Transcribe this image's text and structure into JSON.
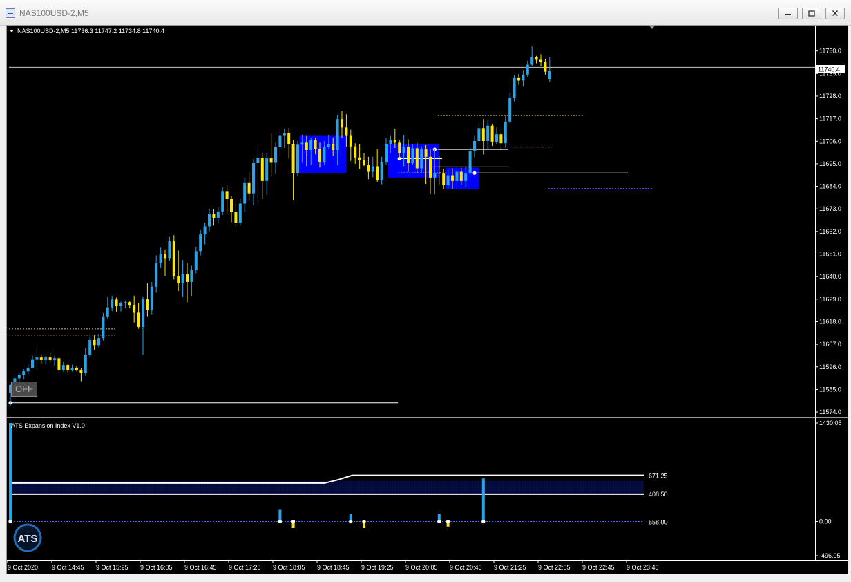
{
  "window": {
    "title": "NAS100USD-2,M5"
  },
  "main_chart": {
    "header": "NAS100USD-2,M5  11736.3 11747.2 11734.8 11740.4",
    "current_price_label": "11740.4",
    "price_axis": [
      "11750.0",
      "11739.0",
      "11728.0",
      "11717.0",
      "11706.0",
      "11695.0",
      "11684.0",
      "11673.0",
      "11662.0",
      "11651.0",
      "11640.0",
      "11629.0",
      "11618.0",
      "11607.0",
      "11596.0",
      "11585.0",
      "11574.0"
    ],
    "off_button_label": "OFF"
  },
  "indicator": {
    "name": "ATS Expansion Index V1.0",
    "axis": [
      "1430.05",
      "0.00",
      "-496.05"
    ],
    "level_labels": [
      "671.25",
      "558.00",
      "408.50"
    ],
    "logo_text": "ATS"
  },
  "time_axis": [
    "9 Oct 2020",
    "9 Oct 14:45",
    "9 Oct 15:25",
    "9 Oct 16:05",
    "9 Oct 16:45",
    "9 Oct 17:25",
    "9 Oct 18:05",
    "9 Oct 18:45",
    "9 Oct 19:25",
    "9 Oct 20:05",
    "9 Oct 20:45",
    "9 Oct 21:25",
    "9 Oct 22:05",
    "9 Oct 22:45",
    "9 Oct 23:40"
  ],
  "colors": {
    "bull": "#2aa4e8",
    "bear": "#ffe800",
    "zone": "#0000ff",
    "background": "#000000",
    "axis_text": "#ffffff"
  },
  "chart_data": {
    "type": "candlestick",
    "symbol": "NAS100USD-2",
    "timeframe": "M5",
    "ylim": [
      11572,
      11760
    ],
    "last_ohlc": {
      "open": 11736.3,
      "high": 11747.2,
      "low": 11734.8,
      "close": 11740.4
    },
    "candles": [
      {
        "o": 11583.5,
        "h": 11587.8,
        "l": 11576.9,
        "c": 11587.2
      },
      {
        "o": 11587.2,
        "h": 11592.6,
        "l": 11585.1,
        "c": 11590.4
      },
      {
        "o": 11590.4,
        "h": 11593.0,
        "l": 11586.9,
        "c": 11592.2
      },
      {
        "o": 11592.2,
        "h": 11594.9,
        "l": 11589.8,
        "c": 11593.8
      },
      {
        "o": 11593.8,
        "h": 11597.4,
        "l": 11591.8,
        "c": 11595.6
      },
      {
        "o": 11595.6,
        "h": 11601.4,
        "l": 11595.2,
        "c": 11599.4
      },
      {
        "o": 11599.4,
        "h": 11605.3,
        "l": 11594.7,
        "c": 11600.6
      },
      {
        "o": 11600.6,
        "h": 11602.2,
        "l": 11597.3,
        "c": 11599.3
      },
      {
        "o": 11599.3,
        "h": 11601.3,
        "l": 11597.3,
        "c": 11600.6
      },
      {
        "o": 11600.6,
        "h": 11602.6,
        "l": 11598.6,
        "c": 11599.3
      },
      {
        "o": 11599.3,
        "h": 11601.3,
        "l": 11596.5,
        "c": 11600.2
      },
      {
        "o": 11600.2,
        "h": 11601.1,
        "l": 11593.0,
        "c": 11594.3
      },
      {
        "o": 11594.3,
        "h": 11598.6,
        "l": 11593.8,
        "c": 11596.9
      },
      {
        "o": 11596.9,
        "h": 11597.5,
        "l": 11593.4,
        "c": 11594.3
      },
      {
        "o": 11594.3,
        "h": 11597.1,
        "l": 11593.8,
        "c": 11595.6
      },
      {
        "o": 11595.6,
        "h": 11596.5,
        "l": 11593.8,
        "c": 11594.3
      },
      {
        "o": 11594.3,
        "h": 11595.6,
        "l": 11589.0,
        "c": 11593.0
      },
      {
        "o": 11593.0,
        "h": 11605.3,
        "l": 11591.6,
        "c": 11602.0
      },
      {
        "o": 11602.0,
        "h": 11611.0,
        "l": 11600.6,
        "c": 11609.1
      },
      {
        "o": 11609.1,
        "h": 11611.4,
        "l": 11604.2,
        "c": 11606.6
      },
      {
        "o": 11606.6,
        "h": 11612.1,
        "l": 11605.5,
        "c": 11610.0
      },
      {
        "o": 11610.0,
        "h": 11622.3,
        "l": 11608.8,
        "c": 11620.6
      },
      {
        "o": 11620.6,
        "h": 11630.2,
        "l": 11619.3,
        "c": 11625.0
      },
      {
        "o": 11625.0,
        "h": 11630.7,
        "l": 11623.2,
        "c": 11628.8
      },
      {
        "o": 11628.8,
        "h": 11629.8,
        "l": 11622.8,
        "c": 11625.9
      },
      {
        "o": 11625.9,
        "h": 11627.8,
        "l": 11623.0,
        "c": 11627.1
      },
      {
        "o": 11627.1,
        "h": 11628.4,
        "l": 11624.5,
        "c": 11627.5
      },
      {
        "o": 11627.5,
        "h": 11628.0,
        "l": 11624.5,
        "c": 11626.2
      },
      {
        "o": 11626.2,
        "h": 11630.7,
        "l": 11617.6,
        "c": 11622.4
      },
      {
        "o": 11622.4,
        "h": 11627.1,
        "l": 11614.6,
        "c": 11615.5
      },
      {
        "o": 11615.5,
        "h": 11630.2,
        "l": 11602.0,
        "c": 11628.9
      },
      {
        "o": 11628.9,
        "h": 11636.8,
        "l": 11620.6,
        "c": 11623.6
      },
      {
        "o": 11623.6,
        "h": 11637.4,
        "l": 11621.7,
        "c": 11635.1
      },
      {
        "o": 11635.1,
        "h": 11650.3,
        "l": 11632.2,
        "c": 11646.7
      },
      {
        "o": 11646.7,
        "h": 11654.1,
        "l": 11644.1,
        "c": 11651.1
      },
      {
        "o": 11651.1,
        "h": 11653.3,
        "l": 11640.4,
        "c": 11649.0
      },
      {
        "o": 11649.0,
        "h": 11659.3,
        "l": 11647.8,
        "c": 11657.2
      },
      {
        "o": 11657.2,
        "h": 11660.2,
        "l": 11638.6,
        "c": 11640.4
      },
      {
        "o": 11640.4,
        "h": 11652.7,
        "l": 11633.0,
        "c": 11636.8
      },
      {
        "o": 11636.8,
        "h": 11648.1,
        "l": 11630.2,
        "c": 11641.2
      },
      {
        "o": 11641.2,
        "h": 11646.5,
        "l": 11627.5,
        "c": 11637.4
      },
      {
        "o": 11637.4,
        "h": 11645.3,
        "l": 11630.6,
        "c": 11643.2
      },
      {
        "o": 11643.2,
        "h": 11654.5,
        "l": 11641.6,
        "c": 11652.4
      },
      {
        "o": 11652.4,
        "h": 11662.6,
        "l": 11650.3,
        "c": 11660.6
      },
      {
        "o": 11660.6,
        "h": 11666.3,
        "l": 11655.7,
        "c": 11664.5
      },
      {
        "o": 11664.5,
        "h": 11673.1,
        "l": 11662.1,
        "c": 11670.7
      },
      {
        "o": 11670.7,
        "h": 11672.9,
        "l": 11664.9,
        "c": 11668.7
      },
      {
        "o": 11668.7,
        "h": 11674.0,
        "l": 11665.8,
        "c": 11671.8
      },
      {
        "o": 11671.8,
        "h": 11683.5,
        "l": 11670.0,
        "c": 11681.4
      },
      {
        "o": 11681.4,
        "h": 11684.9,
        "l": 11670.3,
        "c": 11677.8
      },
      {
        "o": 11677.8,
        "h": 11679.3,
        "l": 11666.5,
        "c": 11671.4
      },
      {
        "o": 11671.4,
        "h": 11676.2,
        "l": 11664.0,
        "c": 11666.3
      },
      {
        "o": 11666.3,
        "h": 11677.8,
        "l": 11664.9,
        "c": 11675.6
      },
      {
        "o": 11675.6,
        "h": 11688.3,
        "l": 11671.3,
        "c": 11685.6
      },
      {
        "o": 11685.6,
        "h": 11690.7,
        "l": 11676.9,
        "c": 11680.6
      },
      {
        "o": 11680.6,
        "h": 11697.3,
        "l": 11674.7,
        "c": 11695.3
      },
      {
        "o": 11695.3,
        "h": 11702.8,
        "l": 11675.7,
        "c": 11698.0
      },
      {
        "o": 11698.0,
        "h": 11700.4,
        "l": 11677.8,
        "c": 11686.6
      },
      {
        "o": 11686.6,
        "h": 11700.4,
        "l": 11680.0,
        "c": 11697.7
      },
      {
        "o": 11697.7,
        "h": 11710.1,
        "l": 11689.3,
        "c": 11695.5
      },
      {
        "o": 11695.5,
        "h": 11705.3,
        "l": 11690.0,
        "c": 11703.2
      },
      {
        "o": 11703.2,
        "h": 11712.0,
        "l": 11697.8,
        "c": 11708.6
      },
      {
        "o": 11708.6,
        "h": 11712.2,
        "l": 11702.7,
        "c": 11710.1
      },
      {
        "o": 11710.1,
        "h": 11712.4,
        "l": 11697.5,
        "c": 11704.5
      },
      {
        "o": 11704.5,
        "h": 11706.6,
        "l": 11677.2,
        "c": 11690.6
      },
      {
        "o": 11690.6,
        "h": 11706.0,
        "l": 11689.0,
        "c": 11704.3
      },
      {
        "o": 11704.3,
        "h": 11709.0,
        "l": 11695.5,
        "c": 11705.3
      },
      {
        "o": 11705.3,
        "h": 11708.6,
        "l": 11693.9,
        "c": 11701.7
      },
      {
        "o": 11701.7,
        "h": 11707.8,
        "l": 11694.5,
        "c": 11706.6
      },
      {
        "o": 11706.6,
        "h": 11707.7,
        "l": 11699.6,
        "c": 11702.2
      },
      {
        "o": 11702.2,
        "h": 11705.3,
        "l": 11693.2,
        "c": 11696.0
      },
      {
        "o": 11696.0,
        "h": 11706.0,
        "l": 11694.6,
        "c": 11703.1
      },
      {
        "o": 11703.1,
        "h": 11709.1,
        "l": 11702.2,
        "c": 11704.5
      },
      {
        "o": 11704.5,
        "h": 11707.8,
        "l": 11698.9,
        "c": 11701.7
      },
      {
        "o": 11701.7,
        "h": 11718.9,
        "l": 11694.3,
        "c": 11716.8
      },
      {
        "o": 11716.8,
        "h": 11720.6,
        "l": 11707.4,
        "c": 11712.7
      },
      {
        "o": 11712.7,
        "h": 11719.2,
        "l": 11703.3,
        "c": 11708.6
      },
      {
        "o": 11708.6,
        "h": 11711.6,
        "l": 11696.4,
        "c": 11703.5
      },
      {
        "o": 11703.5,
        "h": 11705.0,
        "l": 11695.0,
        "c": 11698.1
      },
      {
        "o": 11698.1,
        "h": 11704.5,
        "l": 11692.5,
        "c": 11696.9
      },
      {
        "o": 11696.9,
        "h": 11700.2,
        "l": 11693.9,
        "c": 11694.3
      },
      {
        "o": 11694.3,
        "h": 11698.4,
        "l": 11687.5,
        "c": 11691.1
      },
      {
        "o": 11691.1,
        "h": 11698.4,
        "l": 11688.4,
        "c": 11693.8
      },
      {
        "o": 11693.8,
        "h": 11702.0,
        "l": 11686.0,
        "c": 11687.1
      },
      {
        "o": 11687.1,
        "h": 11698.4,
        "l": 11685.0,
        "c": 11695.7
      },
      {
        "o": 11695.7,
        "h": 11707.4,
        "l": 11694.5,
        "c": 11704.5
      },
      {
        "o": 11704.5,
        "h": 11708.6,
        "l": 11700.2,
        "c": 11706.6
      },
      {
        "o": 11706.6,
        "h": 11712.2,
        "l": 11702.7,
        "c": 11705.3
      },
      {
        "o": 11705.3,
        "h": 11706.6,
        "l": 11696.9,
        "c": 11700.2
      },
      {
        "o": 11700.2,
        "h": 11708.9,
        "l": 11693.8,
        "c": 11703.3
      },
      {
        "o": 11703.3,
        "h": 11706.9,
        "l": 11691.1,
        "c": 11695.3
      },
      {
        "o": 11695.3,
        "h": 11704.5,
        "l": 11694.3,
        "c": 11702.6
      },
      {
        "o": 11702.6,
        "h": 11705.3,
        "l": 11690.6,
        "c": 11692.8
      },
      {
        "o": 11692.8,
        "h": 11703.3,
        "l": 11690.4,
        "c": 11702.0
      },
      {
        "o": 11702.0,
        "h": 11704.1,
        "l": 11685.2,
        "c": 11698.4
      },
      {
        "o": 11698.4,
        "h": 11702.0,
        "l": 11680.2,
        "c": 11688.3
      },
      {
        "o": 11688.3,
        "h": 11702.1,
        "l": 11680.2,
        "c": 11690.6
      },
      {
        "o": 11690.6,
        "h": 11698.9,
        "l": 11685.0,
        "c": 11690.2
      },
      {
        "o": 11690.2,
        "h": 11692.6,
        "l": 11682.7,
        "c": 11684.5
      },
      {
        "o": 11684.5,
        "h": 11691.9,
        "l": 11683.1,
        "c": 11689.4
      },
      {
        "o": 11689.4,
        "h": 11692.8,
        "l": 11682.7,
        "c": 11686.6
      },
      {
        "o": 11686.6,
        "h": 11692.6,
        "l": 11681.9,
        "c": 11691.1
      },
      {
        "o": 11691.1,
        "h": 11693.1,
        "l": 11684.7,
        "c": 11686.6
      },
      {
        "o": 11686.6,
        "h": 11693.8,
        "l": 11683.5,
        "c": 11690.2
      },
      {
        "o": 11690.2,
        "h": 11702.8,
        "l": 11689.6,
        "c": 11701.2
      },
      {
        "o": 11701.2,
        "h": 11708.6,
        "l": 11698.1,
        "c": 11706.1
      },
      {
        "o": 11706.1,
        "h": 11714.3,
        "l": 11704.6,
        "c": 11712.4
      },
      {
        "o": 11712.4,
        "h": 11716.8,
        "l": 11699.5,
        "c": 11706.1
      },
      {
        "o": 11706.1,
        "h": 11716.2,
        "l": 11702.4,
        "c": 11713.6
      },
      {
        "o": 11713.6,
        "h": 11714.4,
        "l": 11703.7,
        "c": 11705.8
      },
      {
        "o": 11705.8,
        "h": 11712.7,
        "l": 11704.5,
        "c": 11709.4
      },
      {
        "o": 11709.4,
        "h": 11711.7,
        "l": 11701.7,
        "c": 11705.0
      },
      {
        "o": 11705.0,
        "h": 11718.1,
        "l": 11702.9,
        "c": 11715.6
      },
      {
        "o": 11715.6,
        "h": 11729.3,
        "l": 11714.7,
        "c": 11727.0
      },
      {
        "o": 11727.0,
        "h": 11738.1,
        "l": 11725.4,
        "c": 11736.8
      },
      {
        "o": 11736.8,
        "h": 11738.8,
        "l": 11733.5,
        "c": 11735.6
      },
      {
        "o": 11735.6,
        "h": 11740.7,
        "l": 11732.6,
        "c": 11738.5
      },
      {
        "o": 11738.5,
        "h": 11745.3,
        "l": 11737.3,
        "c": 11743.3
      },
      {
        "o": 11743.3,
        "h": 11752.2,
        "l": 11742.5,
        "c": 11746.9
      },
      {
        "o": 11746.9,
        "h": 11747.6,
        "l": 11744.0,
        "c": 11745.7
      },
      {
        "o": 11745.7,
        "h": 11748.4,
        "l": 11742.8,
        "c": 11744.8
      },
      {
        "o": 11744.8,
        "h": 11746.2,
        "l": 11738.5,
        "c": 11739.9
      },
      {
        "o": 11736.3,
        "h": 11747.2,
        "l": 11734.8,
        "c": 11740.4
      }
    ],
    "indicator_series": {
      "name": "ATS Expansion Index V1.0",
      "ylim": [
        -496.05,
        1430.05
      ],
      "levels": [
        671.25,
        558.0,
        408.5
      ],
      "upper_line_start": 558.0,
      "upper_line_end": 671.25,
      "spikes": [
        {
          "bar": 0,
          "value": 1430.05
        },
        {
          "bar": 61,
          "value": 171
        },
        {
          "bar": 64,
          "value": -95
        },
        {
          "bar": 77,
          "value": 106
        },
        {
          "bar": 80,
          "value": -95
        },
        {
          "bar": 97,
          "value": 113
        },
        {
          "bar": 99,
          "value": -72
        },
        {
          "bar": 107,
          "value": 625
        }
      ]
    }
  }
}
